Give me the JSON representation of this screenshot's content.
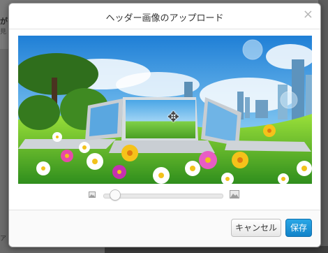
{
  "background": {
    "fragment_1": "が",
    "fragment_2": "見",
    "fragment_3": "　",
    "fragment_4": "ア"
  },
  "modal": {
    "title": "ヘッダー画像のアップロード",
    "close_glyph": "×",
    "zoom_level": 0.1,
    "cursor_glyph": "✥",
    "buttons": {
      "cancel_label": "キャンセル",
      "save_label": "保存"
    },
    "colors": {
      "primary": "#1a8fd6",
      "sky": "#3fa2e8"
    },
    "icons": {
      "zoom_out": "image-small-icon",
      "zoom_in": "image-large-icon",
      "close": "close-icon",
      "move": "move-cursor-icon"
    }
  }
}
